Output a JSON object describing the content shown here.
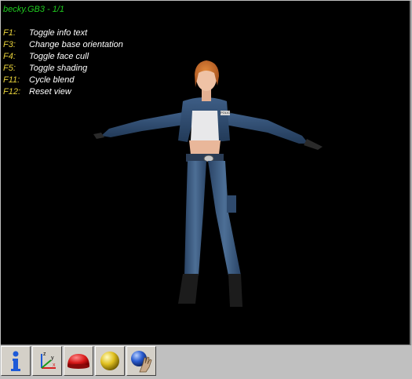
{
  "viewer": {
    "title": "becky.GB3 - 1/1",
    "shortcuts": [
      {
        "key": "F1:",
        "label": "Toggle info text"
      },
      {
        "key": "F3:",
        "label": "Change base orientation"
      },
      {
        "key": "F4:",
        "label": "Toggle face cull"
      },
      {
        "key": "F5:",
        "label": "Toggle shading"
      },
      {
        "key": "F11:",
        "label": "Cycle blend"
      },
      {
        "key": "F12:",
        "label": "Reset view"
      }
    ],
    "model_badge_text": "POLICE"
  },
  "toolbar": {
    "buttons": [
      {
        "icon": "info-icon"
      },
      {
        "icon": "axes-icon",
        "axis_labels": [
          "z",
          "y",
          "x"
        ]
      },
      {
        "icon": "red-dome-icon"
      },
      {
        "icon": "yellow-sphere-icon"
      },
      {
        "icon": "blue-sphere-hand-icon"
      }
    ]
  },
  "colors": {
    "title_green": "#1fcc1f",
    "key_yellow": "#e8d23a",
    "text_white": "#ffffff",
    "viewport_bg": "#000000",
    "chrome_gray": "#c0c0c0"
  }
}
